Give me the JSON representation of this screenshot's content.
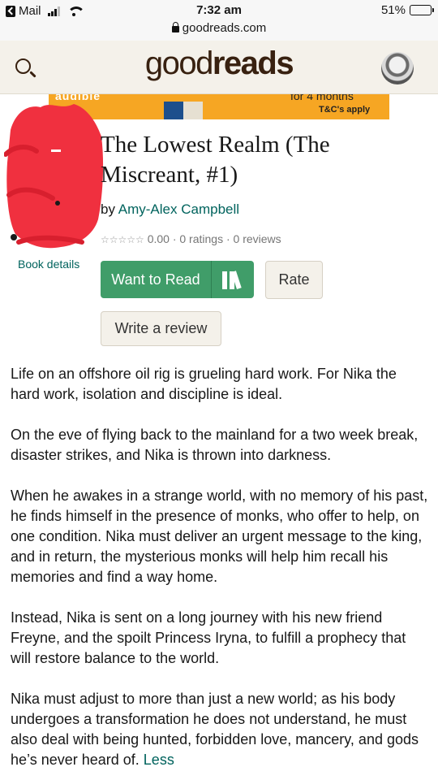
{
  "status_bar": {
    "back_app": "Mail",
    "time": "7:32 am",
    "battery": "51%",
    "battery_level": 0.51
  },
  "browser": {
    "url": "goodreads.com"
  },
  "header": {
    "logo_good": "good",
    "logo_reads": "reads",
    "search_icon": "search-icon",
    "avatar_icon": "user-avatar"
  },
  "ad": {
    "brand": "audible",
    "offer": "for 4 months",
    "terms": "T&C's apply"
  },
  "book": {
    "title": "The Lowest Realm (The Miscreant, #1)",
    "by_label": "by",
    "author": "Amy-Alex Campbell",
    "stars": "☆☆☆☆☆",
    "rating_text": "0.00 · 0 ratings · 0 reviews",
    "details_link": "Book details"
  },
  "actions": {
    "want_to_read": "Want to Read",
    "rate": "Rate",
    "write_review": "Write a review"
  },
  "description": {
    "paragraphs": [
      "Life on an offshore oil rig is grueling hard work. For Nika the hard work, isolation and discipline is ideal.",
      "On the eve of flying back to the mainland for a two week break, disaster strikes, and Nika is thrown into darkness.",
      "When he awakes in a strange world, with no memory of his past, he finds himself in the presence of monks, who offer to help, on one condition. Nika must deliver an urgent message to the king, and in return, the mysterious monks will help him recall his memories and find a way home.",
      "Instead, Nika is sent on a long journey with his new friend Freyne, and the spoilt Princess Iryna, to fulfill a prophecy that will restore balance to the world.",
      "Nika must adjust to more than just a new world; as his body undergoes a transformation he does not understand, he must also deal with being hunted, forbidden love, mancery, and gods he’s never heard of."
    ],
    "less_link": "Less"
  },
  "colors": {
    "brand_brown": "#382110",
    "link_teal": "#00635d",
    "want_green": "#409d69",
    "header_bg": "#f4f1ea",
    "ad_orange": "#f6a623",
    "redaction": "#f0303f"
  }
}
